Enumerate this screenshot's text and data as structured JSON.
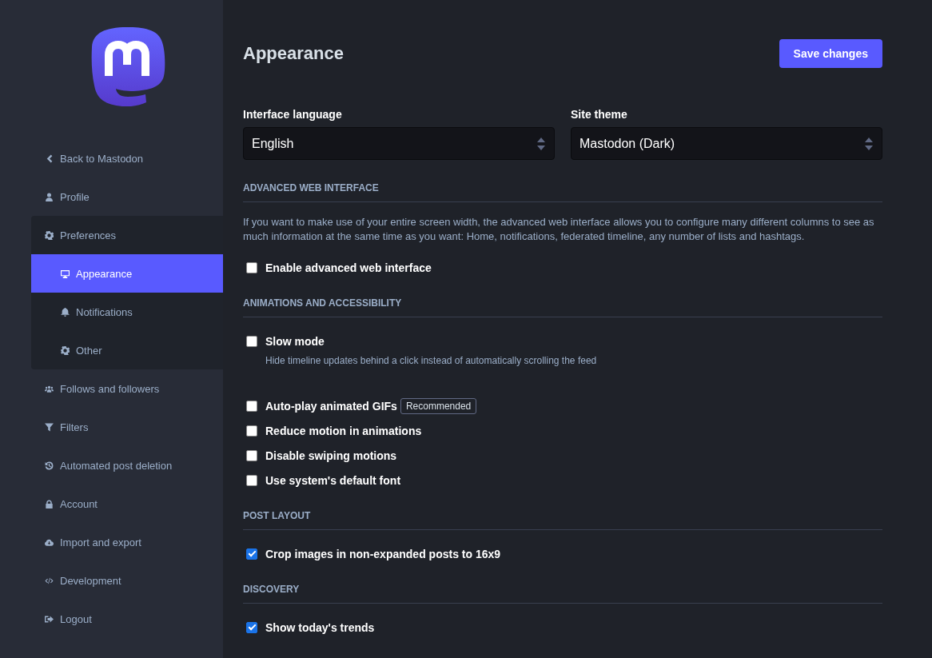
{
  "sidebar": {
    "items": [
      {
        "label": "Back to Mastodon",
        "selected": false
      },
      {
        "label": "Profile",
        "selected": false
      },
      {
        "label": "Preferences",
        "selected": false,
        "expanded": true,
        "children": [
          {
            "label": "Appearance",
            "selected": true
          },
          {
            "label": "Notifications",
            "selected": false
          },
          {
            "label": "Other",
            "selected": false
          }
        ]
      },
      {
        "label": "Follows and followers",
        "selected": false
      },
      {
        "label": "Filters",
        "selected": false
      },
      {
        "label": "Automated post deletion",
        "selected": false
      },
      {
        "label": "Account",
        "selected": false
      },
      {
        "label": "Import and export",
        "selected": false
      },
      {
        "label": "Development",
        "selected": false
      },
      {
        "label": "Logout",
        "selected": false
      }
    ]
  },
  "page": {
    "title": "Appearance",
    "save_button": "Save changes",
    "selects": [
      {
        "label": "Interface language",
        "value": "English"
      },
      {
        "label": "Site theme",
        "value": "Mastodon (Dark)"
      }
    ],
    "sections": [
      {
        "heading": "ADVANCED WEB INTERFACE",
        "description": "If you want to make use of your entire screen width, the advanced web interface allows you to configure many different columns to see as much information at the same time as you want: Home, notifications, federated timeline, any number of lists and hashtags.",
        "options": [
          {
            "label": "Enable advanced web interface",
            "checked": false
          }
        ]
      },
      {
        "heading": "ANIMATIONS AND ACCESSIBILITY",
        "options": [
          {
            "label": "Slow mode",
            "checked": false,
            "hint": "Hide timeline updates behind a click instead of automatically scrolling the feed"
          },
          {
            "label": "Auto-play animated GIFs",
            "checked": false,
            "badge": "Recommended"
          },
          {
            "label": "Reduce motion in animations",
            "checked": false
          },
          {
            "label": "Disable swiping motions",
            "checked": false
          },
          {
            "label": "Use system's default font",
            "checked": false
          }
        ]
      },
      {
        "heading": "POST LAYOUT",
        "options": [
          {
            "label": "Crop images in non-expanded posts to 16x9",
            "checked": true
          }
        ]
      },
      {
        "heading": "DISCOVERY",
        "options": [
          {
            "label": "Show today's trends",
            "checked": true
          }
        ]
      }
    ]
  }
}
